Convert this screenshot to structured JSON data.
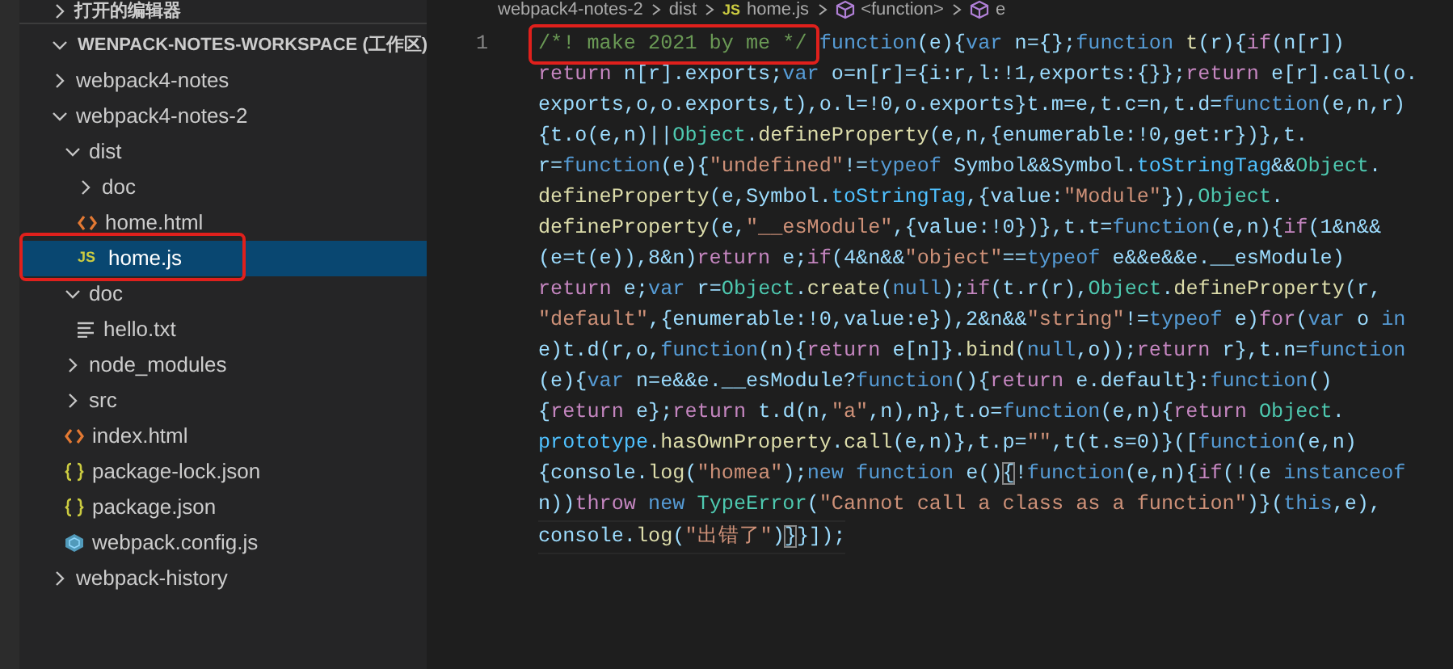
{
  "breadcrumb": [
    {
      "label": "webpack4-notes-2",
      "kind": "folder"
    },
    {
      "label": "dist",
      "kind": "folder"
    },
    {
      "label": "home.js",
      "kind": "js",
      "icon_text": "JS"
    },
    {
      "label": "<function>",
      "kind": "symbol"
    },
    {
      "label": "e",
      "kind": "symbol"
    }
  ],
  "sidebar": {
    "open_editors": {
      "label": "打开的编辑器",
      "expanded": false
    },
    "workspace": {
      "label": "WENPACK-NOTES-WORKSPACE (工作区)",
      "expanded": true
    },
    "tree": [
      {
        "label": "webpack4-notes",
        "kind": "folder",
        "expanded": false,
        "selected": false
      },
      {
        "label": "webpack4-notes-2",
        "kind": "folder",
        "expanded": true,
        "selected": false,
        "children": [
          {
            "label": "dist",
            "kind": "folder",
            "expanded": true,
            "selected": false,
            "children": [
              {
                "label": "doc",
                "kind": "folder",
                "expanded": false,
                "selected": false
              },
              {
                "label": "home.html",
                "kind": "html",
                "selected": false
              },
              {
                "label": "home.js",
                "kind": "js",
                "icon_text": "JS",
                "selected": true,
                "annotated": true
              }
            ]
          },
          {
            "label": "doc",
            "kind": "folder",
            "expanded": true,
            "selected": false,
            "children": [
              {
                "label": "hello.txt",
                "kind": "txt",
                "selected": false
              }
            ]
          },
          {
            "label": "node_modules",
            "kind": "folder",
            "expanded": false,
            "selected": false
          },
          {
            "label": "src",
            "kind": "folder",
            "expanded": false,
            "selected": false
          },
          {
            "label": "index.html",
            "kind": "html",
            "selected": false
          },
          {
            "label": "package-lock.json",
            "kind": "json",
            "selected": false
          },
          {
            "label": "package.json",
            "kind": "json",
            "selected": false
          },
          {
            "label": "webpack.config.js",
            "kind": "webpack",
            "selected": false
          }
        ]
      },
      {
        "label": "webpack-history",
        "kind": "folder",
        "expanded": false,
        "selected": false
      }
    ]
  },
  "editor": {
    "line_number": "1",
    "lines": [
      [
        {
          "text": "/*! make 2021 by me */",
          "kind": "comment",
          "annotated": true
        },
        {
          "text": " function",
          "kind": "storage"
        },
        {
          "text": "(e){",
          "kind": "ident"
        },
        {
          "text": "var",
          "kind": "storage"
        },
        {
          "text": " n={};",
          "kind": "ident"
        },
        {
          "text": "function",
          "kind": "storage"
        },
        {
          "text": " t",
          "kind": "func"
        },
        {
          "text": "(r){",
          "kind": "ident"
        },
        {
          "text": "if",
          "kind": "keyword"
        },
        {
          "text": "(n[r])",
          "kind": "ident"
        }
      ],
      [
        {
          "text": "return",
          "kind": "keyword"
        },
        {
          "text": " n[r].exports;",
          "kind": "ident"
        },
        {
          "text": "var",
          "kind": "storage"
        },
        {
          "text": " o=n[r]={i:r,l:!1,exports:{}};",
          "kind": "ident"
        },
        {
          "text": "return",
          "kind": "keyword"
        },
        {
          "text": " e[r].call(o.",
          "kind": "ident"
        }
      ],
      [
        {
          "text": "exports,o,o.exports,t),o.l=!0,o.exports}t.m=e,t.c=n,t.d=",
          "kind": "ident"
        },
        {
          "text": "function",
          "kind": "storage"
        },
        {
          "text": "(e,n,r)",
          "kind": "ident"
        }
      ],
      [
        {
          "text": "{t.o(e,n)||",
          "kind": "ident"
        },
        {
          "text": "Object",
          "kind": "type"
        },
        {
          "text": ".",
          "kind": "ident"
        },
        {
          "text": "defineProperty",
          "kind": "func"
        },
        {
          "text": "(e,n,{enumerable:!0,get:r})},t.",
          "kind": "ident"
        }
      ],
      [
        {
          "text": "r=",
          "kind": "ident"
        },
        {
          "text": "function",
          "kind": "storage"
        },
        {
          "text": "(e){",
          "kind": "ident"
        },
        {
          "text": "\"undefined\"",
          "kind": "string"
        },
        {
          "text": "!=",
          "kind": "ident"
        },
        {
          "text": "typeof",
          "kind": "storage"
        },
        {
          "text": " Symbol&&Symbol.",
          "kind": "ident"
        },
        {
          "text": "toStringTag",
          "kind": "prop"
        },
        {
          "text": "&&",
          "kind": "ident"
        },
        {
          "text": "Object",
          "kind": "type"
        },
        {
          "text": ".",
          "kind": "ident"
        }
      ],
      [
        {
          "text": "defineProperty",
          "kind": "func"
        },
        {
          "text": "(e,Symbol.",
          "kind": "ident"
        },
        {
          "text": "toStringTag",
          "kind": "prop"
        },
        {
          "text": ",{value:",
          "kind": "ident"
        },
        {
          "text": "\"Module\"",
          "kind": "string"
        },
        {
          "text": "}),",
          "kind": "ident"
        },
        {
          "text": "Object",
          "kind": "type"
        },
        {
          "text": ".",
          "kind": "ident"
        }
      ],
      [
        {
          "text": "defineProperty",
          "kind": "func"
        },
        {
          "text": "(e,",
          "kind": "ident"
        },
        {
          "text": "\"__esModule\"",
          "kind": "string"
        },
        {
          "text": ",{value:!0})},t.t=",
          "kind": "ident"
        },
        {
          "text": "function",
          "kind": "storage"
        },
        {
          "text": "(e,n){",
          "kind": "ident"
        },
        {
          "text": "if",
          "kind": "keyword"
        },
        {
          "text": "(1&n&&",
          "kind": "ident"
        }
      ],
      [
        {
          "text": "(e=t(e)),8&n)",
          "kind": "ident"
        },
        {
          "text": "return",
          "kind": "keyword"
        },
        {
          "text": " e;",
          "kind": "ident"
        },
        {
          "text": "if",
          "kind": "keyword"
        },
        {
          "text": "(4&n&&",
          "kind": "ident"
        },
        {
          "text": "\"object\"",
          "kind": "string"
        },
        {
          "text": "==",
          "kind": "ident"
        },
        {
          "text": "typeof",
          "kind": "storage"
        },
        {
          "text": " e&&e&&e.__esModule)",
          "kind": "ident"
        }
      ],
      [
        {
          "text": "return",
          "kind": "keyword"
        },
        {
          "text": " e;",
          "kind": "ident"
        },
        {
          "text": "var",
          "kind": "storage"
        },
        {
          "text": " r=",
          "kind": "ident"
        },
        {
          "text": "Object",
          "kind": "type"
        },
        {
          "text": ".",
          "kind": "ident"
        },
        {
          "text": "create",
          "kind": "func"
        },
        {
          "text": "(",
          "kind": "ident"
        },
        {
          "text": "null",
          "kind": "storage"
        },
        {
          "text": ");",
          "kind": "ident"
        },
        {
          "text": "if",
          "kind": "keyword"
        },
        {
          "text": "(t.r(r),",
          "kind": "ident"
        },
        {
          "text": "Object",
          "kind": "type"
        },
        {
          "text": ".",
          "kind": "ident"
        },
        {
          "text": "defineProperty",
          "kind": "func"
        },
        {
          "text": "(r,",
          "kind": "ident"
        }
      ],
      [
        {
          "text": "\"default\"",
          "kind": "string"
        },
        {
          "text": ",{enumerable:!0,value:e}),2&n&&",
          "kind": "ident"
        },
        {
          "text": "\"string\"",
          "kind": "string"
        },
        {
          "text": "!=",
          "kind": "ident"
        },
        {
          "text": "typeof",
          "kind": "storage"
        },
        {
          "text": " e)",
          "kind": "ident"
        },
        {
          "text": "for",
          "kind": "keyword"
        },
        {
          "text": "(",
          "kind": "ident"
        },
        {
          "text": "var",
          "kind": "storage"
        },
        {
          "text": " o ",
          "kind": "ident"
        },
        {
          "text": "in",
          "kind": "storage"
        }
      ],
      [
        {
          "text": "e)t.d(r,o,",
          "kind": "ident"
        },
        {
          "text": "function",
          "kind": "storage"
        },
        {
          "text": "(n){",
          "kind": "ident"
        },
        {
          "text": "return",
          "kind": "keyword"
        },
        {
          "text": " e[n]}.",
          "kind": "ident"
        },
        {
          "text": "bind",
          "kind": "func"
        },
        {
          "text": "(",
          "kind": "ident"
        },
        {
          "text": "null",
          "kind": "storage"
        },
        {
          "text": ",o));",
          "kind": "ident"
        },
        {
          "text": "return",
          "kind": "keyword"
        },
        {
          "text": " r},t.n=",
          "kind": "ident"
        },
        {
          "text": "function",
          "kind": "storage"
        }
      ],
      [
        {
          "text": "(e){",
          "kind": "ident"
        },
        {
          "text": "var",
          "kind": "storage"
        },
        {
          "text": " n=e&&e.__esModule?",
          "kind": "ident"
        },
        {
          "text": "function",
          "kind": "storage"
        },
        {
          "text": "(){",
          "kind": "ident"
        },
        {
          "text": "return",
          "kind": "keyword"
        },
        {
          "text": " e.default}:",
          "kind": "ident"
        },
        {
          "text": "function",
          "kind": "storage"
        },
        {
          "text": "()",
          "kind": "ident"
        }
      ],
      [
        {
          "text": "{",
          "kind": "ident"
        },
        {
          "text": "return",
          "kind": "keyword"
        },
        {
          "text": " e};",
          "kind": "ident"
        },
        {
          "text": "return",
          "kind": "keyword"
        },
        {
          "text": " t.d(n,",
          "kind": "ident"
        },
        {
          "text": "\"a\"",
          "kind": "string"
        },
        {
          "text": ",n),n},t.o=",
          "kind": "ident"
        },
        {
          "text": "function",
          "kind": "storage"
        },
        {
          "text": "(e,n){",
          "kind": "ident"
        },
        {
          "text": "return",
          "kind": "keyword"
        },
        {
          "text": " Object",
          "kind": "type"
        },
        {
          "text": ".",
          "kind": "ident"
        }
      ],
      [
        {
          "text": "prototype",
          "kind": "prop"
        },
        {
          "text": ".",
          "kind": "ident"
        },
        {
          "text": "hasOwnProperty",
          "kind": "func"
        },
        {
          "text": ".",
          "kind": "ident"
        },
        {
          "text": "call",
          "kind": "func"
        },
        {
          "text": "(e,n)},t.p=",
          "kind": "ident"
        },
        {
          "text": "\"\"",
          "kind": "string"
        },
        {
          "text": ",t(t.s=0)}([",
          "kind": "ident"
        },
        {
          "text": "function",
          "kind": "storage"
        },
        {
          "text": "(e,n)",
          "kind": "ident"
        }
      ],
      [
        {
          "text": "{console.",
          "kind": "ident"
        },
        {
          "text": "log",
          "kind": "func"
        },
        {
          "text": "(",
          "kind": "ident"
        },
        {
          "text": "\"homea\"",
          "kind": "string"
        },
        {
          "text": ");",
          "kind": "ident"
        },
        {
          "text": "new",
          "kind": "storage"
        },
        {
          "text": " function",
          "kind": "storage"
        },
        {
          "text": " e()",
          "kind": "ident"
        },
        {
          "text": "{",
          "kind": "bracket"
        },
        {
          "text": "!",
          "kind": "ident"
        },
        {
          "text": "function",
          "kind": "storage"
        },
        {
          "text": "(e,n){",
          "kind": "ident"
        },
        {
          "text": "if",
          "kind": "keyword"
        },
        {
          "text": "(!(e ",
          "kind": "ident"
        },
        {
          "text": "instanceof",
          "kind": "storage"
        }
      ],
      [
        {
          "text": "n))",
          "kind": "ident"
        },
        {
          "text": "throw",
          "kind": "keyword"
        },
        {
          "text": " new",
          "kind": "storage"
        },
        {
          "text": " TypeError",
          "kind": "type"
        },
        {
          "text": "(",
          "kind": "ident"
        },
        {
          "text": "\"Cannot call a class as a function\"",
          "kind": "string"
        },
        {
          "text": ")}(",
          "kind": "ident"
        },
        {
          "text": "this",
          "kind": "storage"
        },
        {
          "text": ",e),",
          "kind": "ident"
        }
      ],
      [
        {
          "text": "console.",
          "kind": "ident"
        },
        {
          "text": "log",
          "kind": "func"
        },
        {
          "text": "(",
          "kind": "ident"
        },
        {
          "text": "\"出错了\"",
          "kind": "string"
        },
        {
          "text": ")",
          "kind": "ident"
        },
        {
          "text": "}",
          "kind": "bracket"
        },
        {
          "text": "}]);",
          "kind": "ident"
        }
      ]
    ]
  }
}
